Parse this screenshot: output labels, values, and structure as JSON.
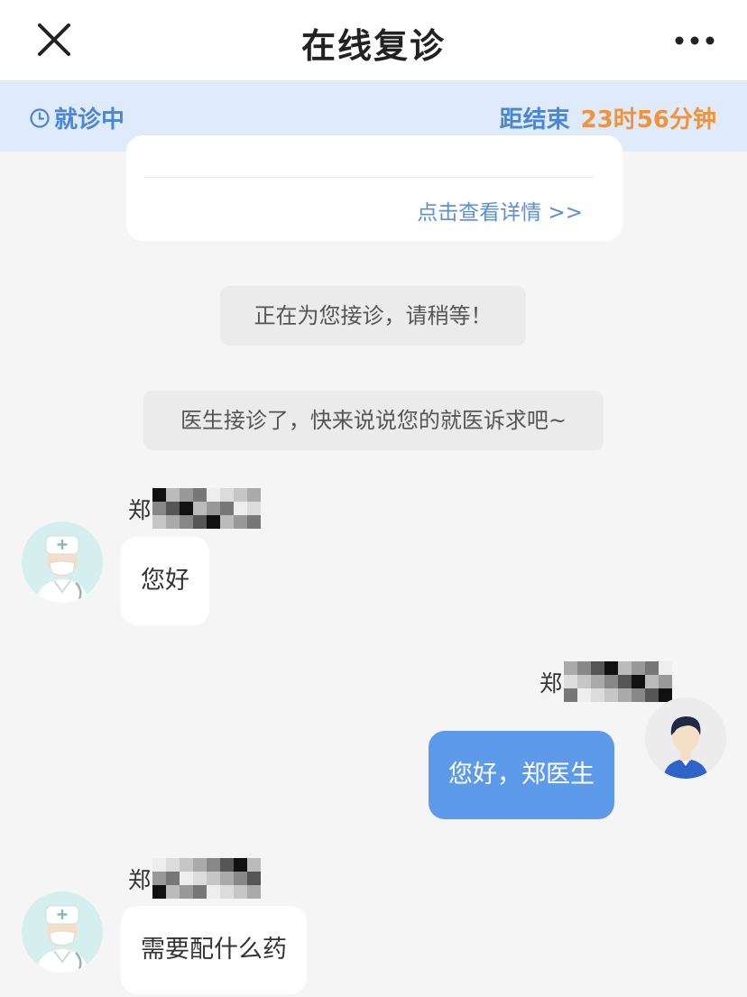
{
  "header": {
    "title": "在线复诊"
  },
  "status": {
    "text": "就诊中",
    "countdown_label": "距结束",
    "countdown_value": "23时56分钟"
  },
  "info_card": {
    "link": "点击查看详情 >>"
  },
  "system_messages": [
    "正在为您接诊，请稍等！",
    "医生接诊了，快来说说您的就医诉求吧~"
  ],
  "messages": [
    {
      "sender": "郑",
      "text": "您好"
    },
    {
      "sender": "郑",
      "text": "您好，郑医生"
    },
    {
      "sender": "郑",
      "text": "需要配什么药"
    }
  ],
  "colors": {
    "accent": "#4a86d6",
    "countdown": "#f0933b",
    "bubble_self": "#5d9aea",
    "status_bg": "#dfeafb"
  }
}
